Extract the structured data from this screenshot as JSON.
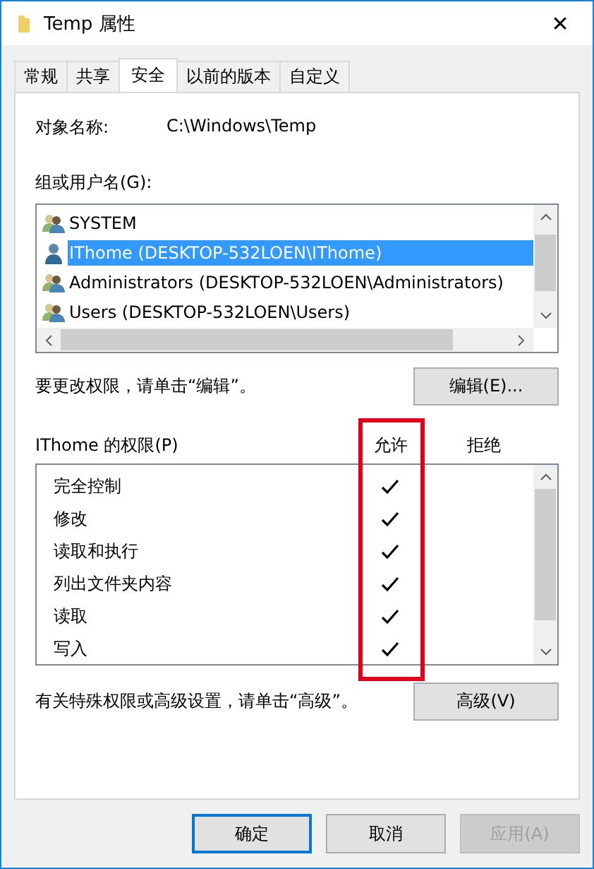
{
  "window": {
    "title": "Temp 属性",
    "close": "✕"
  },
  "tabs": [
    {
      "label": "常规",
      "selected": false
    },
    {
      "label": "共享",
      "selected": false
    },
    {
      "label": "安全",
      "selected": true
    },
    {
      "label": "以前的版本",
      "selected": false
    },
    {
      "label": "自定义",
      "selected": false
    }
  ],
  "object_name": {
    "label": "对象名称:",
    "value": "C:\\Windows\\Temp"
  },
  "users": {
    "label": "组或用户名(G):",
    "items": [
      {
        "name": "SYSTEM",
        "kind": "group",
        "selected": false
      },
      {
        "name": "IThome (DESKTOP-532LOEN\\IThome)",
        "kind": "user",
        "selected": true
      },
      {
        "name": "Administrators (DESKTOP-532LOEN\\Administrators)",
        "kind": "group",
        "selected": false
      },
      {
        "name": "Users (DESKTOP-532LOEN\\Users)",
        "kind": "group",
        "selected": false
      }
    ]
  },
  "edit_hint": "要更改权限，请单击“编辑”。",
  "edit_button": "编辑(E)...",
  "permissions": {
    "label": "IThome 的权限(P)",
    "allow_header": "允许",
    "deny_header": "拒绝",
    "items": [
      {
        "name": "完全控制",
        "allow": true,
        "deny": false
      },
      {
        "name": "修改",
        "allow": true,
        "deny": false
      },
      {
        "name": "读取和执行",
        "allow": true,
        "deny": false
      },
      {
        "name": "列出文件夹内容",
        "allow": true,
        "deny": false
      },
      {
        "name": "读取",
        "allow": true,
        "deny": false
      },
      {
        "name": "写入",
        "allow": true,
        "deny": false
      }
    ]
  },
  "advanced_hint": "有关特殊权限或高级设置，请单击“高级”。",
  "advanced_button": "高级(V)",
  "buttons": [
    {
      "label": "确定",
      "default": true,
      "disabled": false
    },
    {
      "label": "取消",
      "default": false,
      "disabled": false
    },
    {
      "label": "应用(A)",
      "default": false,
      "disabled": true
    }
  ]
}
